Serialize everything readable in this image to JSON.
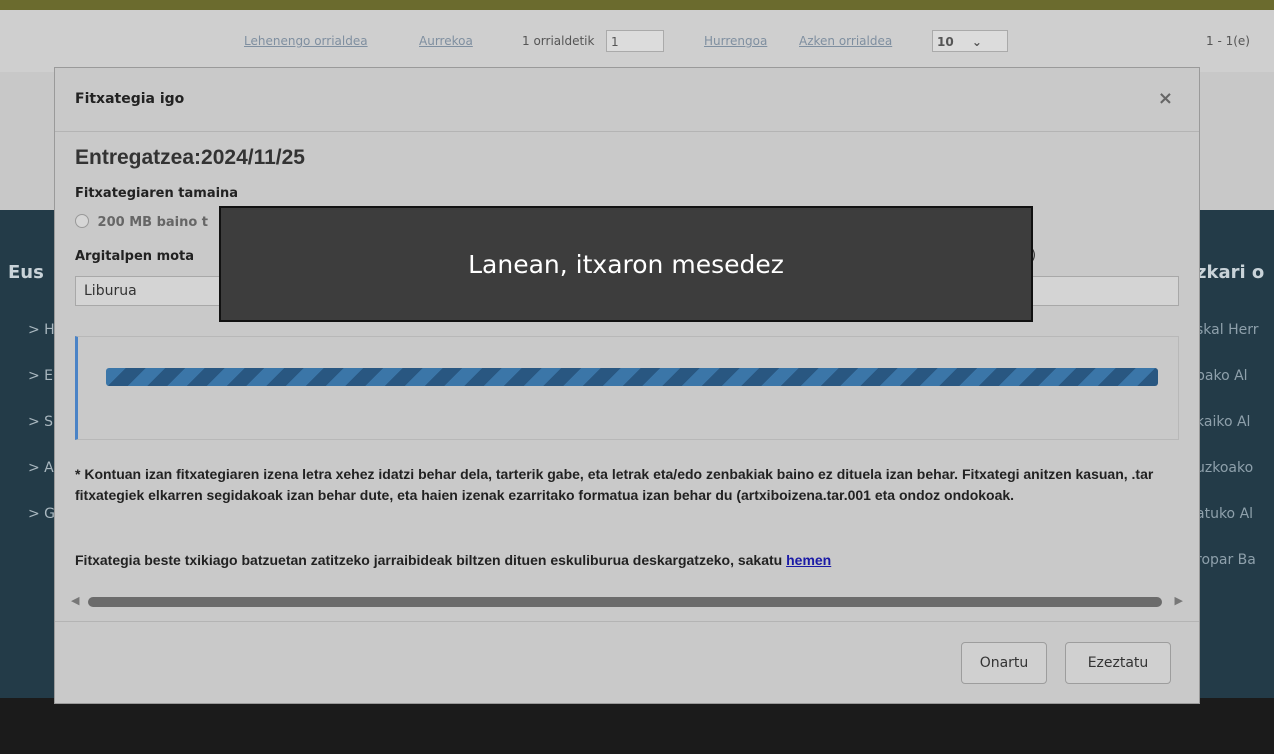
{
  "background": {
    "pager": {
      "first": "Lehenengo orrialdea",
      "prev": "Aurrekoa",
      "page_of": "1 orrialdetik",
      "page_value": "1",
      "next": "Hurrengoa",
      "last": "Azken orrialdea",
      "page_size": "10",
      "range": "1 - 1(e)"
    },
    "footer_left": {
      "title": "Eus",
      "items": [
        "> H",
        "> E",
        "> S",
        "> A",
        "> G"
      ]
    },
    "footer_right": {
      "title": "zkari o",
      "items": [
        "skal Herr",
        "bako Al",
        "kaiko Al",
        "uzkoako",
        "atuko Al",
        "ropar Ba"
      ]
    }
  },
  "modal": {
    "title": "Fitxategia igo",
    "close_icon": "×",
    "delivery": "Entregatzea:2024/11/25",
    "file_size_label": "Fitxategiaren tamaina",
    "radio_label": "200 MB baino t",
    "publication_type_label": "Argitalpen mota",
    "publication_type_value": "Liburua",
    "right_label_fragment": ")",
    "progress": 1.0,
    "notice": "* Kontuan izan fitxategiaren izena letra xehez idatzi behar dela, tarterik gabe, eta letrak eta/edo zenbakiak baino ez dituela izan behar. Fitxategi anitzen kasuan, .tar fitxategiek elkarren segidakoak izan behar dute, eta haien izenak ezarritako formatua izan behar du (artxiboizena.tar.001 eta ondoz ondokoak.",
    "manual_text": "Fitxategia beste txikiago batzuetan zatitzeko jarraibideak biltzen dituen eskuliburua deskargatzeko, sakatu ",
    "manual_link": "hemen",
    "accept_button": "Onartu",
    "cancel_button": "Ezeztatu"
  },
  "loading": {
    "message": "Lanean, itxaron mesedez"
  }
}
